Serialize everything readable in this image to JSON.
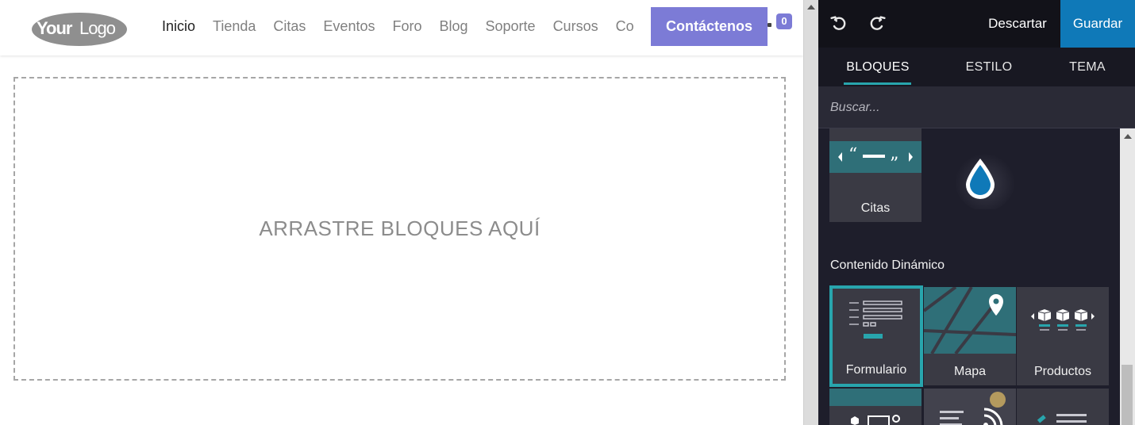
{
  "site": {
    "logo_text": "YourLogo",
    "nav": [
      {
        "label": "Inicio",
        "active": true
      },
      {
        "label": "Tienda",
        "active": false
      },
      {
        "label": "Citas",
        "active": false
      },
      {
        "label": "Eventos",
        "active": false
      },
      {
        "label": "Foro",
        "active": false
      },
      {
        "label": "Blog",
        "active": false
      },
      {
        "label": "Soporte",
        "active": false
      },
      {
        "label": "Cursos",
        "active": false
      },
      {
        "label": "Co",
        "active": false
      }
    ],
    "cart_count": "0",
    "contact_label": "Contáctenos",
    "drop_zone_text": "ARRASTRE BLOQUES AQUÍ"
  },
  "editor": {
    "undo_icon": "undo-icon",
    "redo_icon": "redo-icon",
    "discard_label": "Descartar",
    "save_label": "Guardar",
    "tabs": [
      {
        "label": "BLOQUES",
        "active": true
      },
      {
        "label": "ESTILO",
        "active": false
      },
      {
        "label": "TEMA",
        "active": false
      }
    ],
    "search_placeholder": "Buscar...",
    "blocks_top": {
      "label": "Citas",
      "icon": "quotes-icon"
    },
    "drop_icon": "water-drop-icon",
    "section_heading": "Contenido Dinámico",
    "dynamic_blocks": [
      {
        "label": "Formulario",
        "icon": "form-icon",
        "selected": true
      },
      {
        "label": "Mapa",
        "icon": "map-icon",
        "selected": false
      },
      {
        "label": "Productos",
        "icon": "products-icon",
        "selected": false
      }
    ],
    "colors": {
      "accent": "#28a5ad",
      "save": "#0f79b8",
      "brand": "#7c7bd6",
      "panel_bg": "#1e1e2b"
    }
  }
}
